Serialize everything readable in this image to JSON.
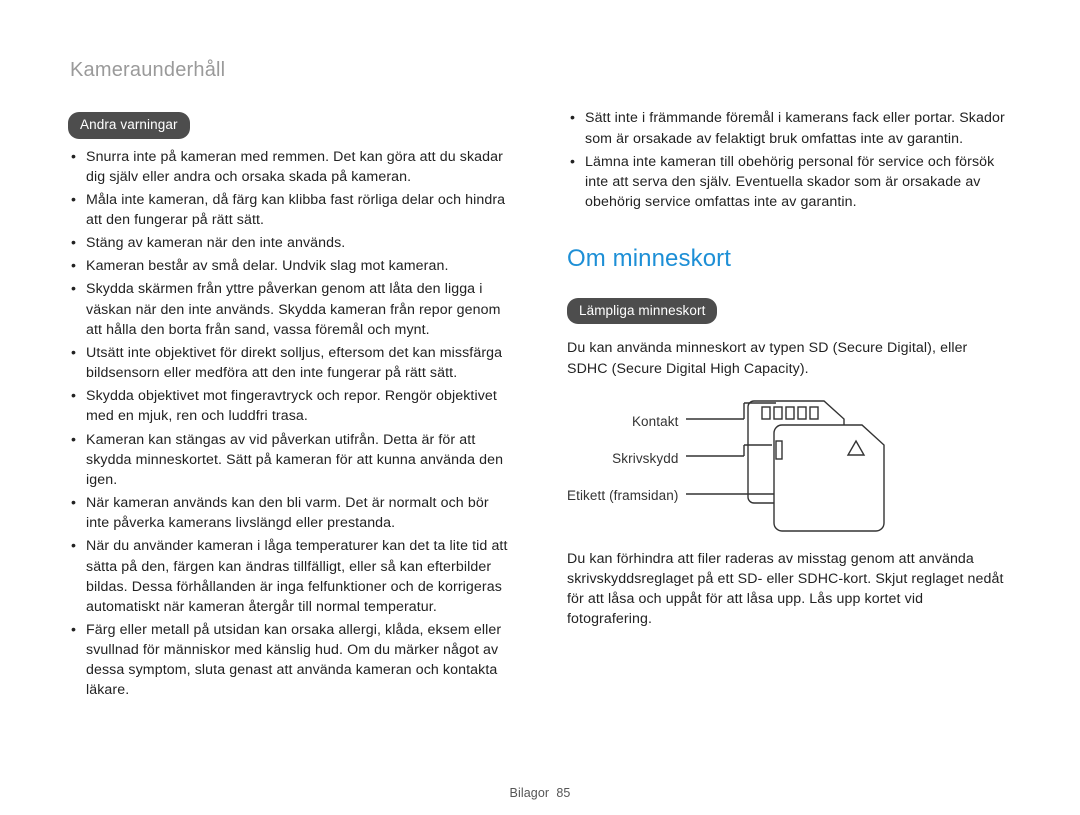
{
  "page": {
    "title": "Kameraunderhåll",
    "footer_section": "Bilagor",
    "page_number": "85"
  },
  "left": {
    "pill": "Andra varningar",
    "bullets": [
      "Snurra inte på kameran med remmen. Det kan göra att du skadar dig själv eller andra och orsaka skada på kameran.",
      "Måla inte kameran, då färg kan klibba fast rörliga delar och hindra att den fungerar på rätt sätt.",
      "Stäng av kameran när den inte används.",
      "Kameran består av små delar. Undvik slag mot kameran.",
      "Skydda skärmen från yttre påverkan genom att låta den ligga i väskan när den inte används. Skydda kameran från repor genom att hålla den borta från sand, vassa föremål och mynt.",
      "Utsätt inte objektivet för direkt solljus, eftersom det kan missfärga bildsensorn eller medföra att den inte fungerar på rätt sätt.",
      "Skydda objektivet mot fingeravtryck och repor. Rengör objektivet med en mjuk, ren och luddfri trasa.",
      "Kameran kan stängas av vid påverkan utifrån. Detta är för att skydda minneskortet. Sätt på kameran för att kunna använda den igen.",
      "När kameran används kan den bli varm.  Det är normalt och bör inte påverka kamerans livslängd eller prestanda.",
      "När du använder kameran i låga temperaturer kan det ta lite tid att sätta på den, färgen kan ändras tillfälligt, eller så kan efterbilder bildas. Dessa förhållanden är inga felfunktioner och de korrigeras automatiskt när kameran återgår till normal temperatur.",
      "Färg eller metall på utsidan kan orsaka allergi, klåda, eksem eller svullnad för människor med känslig hud. Om du märker något av dessa symptom, sluta genast att använda kameran och kontakta läkare."
    ]
  },
  "right": {
    "top_bullets": [
      "Sätt inte i främmande föremål i kamerans fack eller portar. Skador som är orsakade av felaktigt bruk omfattas inte av garantin.",
      "Lämna inte kameran till obehörig personal för service och försök inte att serva den själv. Eventuella skador som är orsakade av obehörig service omfattas inte av garantin."
    ],
    "heading": "Om minneskort",
    "pill": "Lämpliga minneskort",
    "intro": "Du kan använda minneskort av typen SD (Secure Digital), eller SDHC (Secure Digital High Capacity).",
    "labels": {
      "contact": "Kontakt",
      "write_protect": "Skrivskydd",
      "label": "Etikett (framsidan)"
    },
    "outro": "Du kan förhindra att filer raderas av misstag genom att använda skrivskyddsreglaget på ett SD- eller SDHC-kort. Skjut reglaget nedåt för att låsa och uppåt för att låsa upp. Lås upp kortet vid fotografering."
  }
}
